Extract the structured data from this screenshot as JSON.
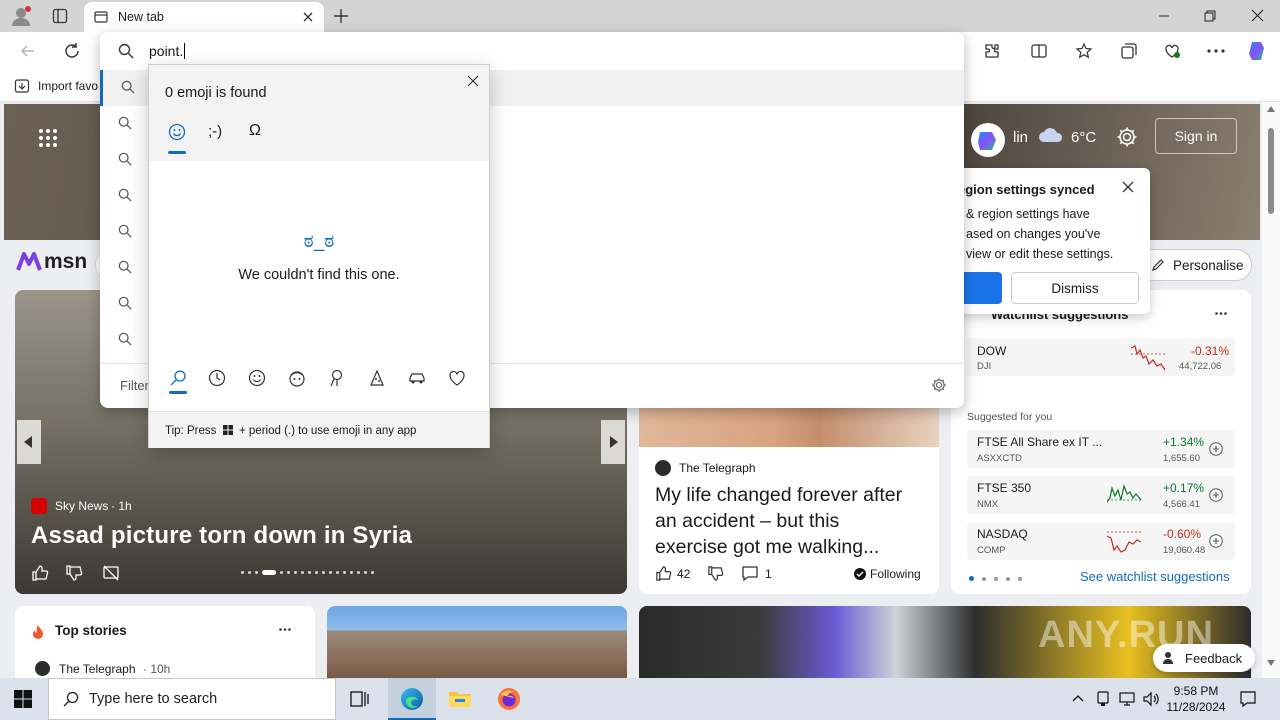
{
  "browser": {
    "tab_title": "New tab",
    "address_text": "point.",
    "bookmark_import": "Import favo",
    "filter_label": "Filter"
  },
  "emoji_panel": {
    "status": "0 emoji is found",
    "kaomoji_tab": ";-)",
    "symbols_tab": "Ω",
    "empty_face": "ಠ_ಠ",
    "empty_text": "We couldn't find this one.",
    "tip_prefix": "Tip: Press",
    "tip_suffix": "+ period (.) to use emoji in any app"
  },
  "msn": {
    "logo": "msn",
    "weather_city": "Berlin",
    "weather_city_visible": "lin",
    "weather_temp": "6°C",
    "sign_in": "Sign in",
    "personalise": "Personalise"
  },
  "popup": {
    "title": "egion settings synced",
    "body_line1": "& region settings have",
    "body_line2": "ased on changes you've",
    "body_line3": "view or edit these settings.",
    "dismiss": "Dismiss"
  },
  "hero_story": {
    "source": "Sky News",
    "age": "· 1h",
    "title": "Assad picture torn down in Syria"
  },
  "telegraph_card": {
    "source": "The Telegraph",
    "title_line1": "My life changed forever after",
    "title_line2": "an accident – but this",
    "title_line3": "exercise got me walking...",
    "likes": "42",
    "comments": "1",
    "following": "Following"
  },
  "watchlist": {
    "title": "Watchlist suggestions",
    "top": {
      "name": "DOW",
      "symbol": "DJI",
      "change": "-0.31%",
      "value": "44,722.06"
    },
    "suggested_label": "Suggested for you",
    "items": [
      {
        "name": "FTSE All Share ex IT ...",
        "symbol": "ASXXCTD",
        "change": "+1.34%",
        "value": "1,655.60"
      },
      {
        "name": "FTSE 350",
        "symbol": "NMX",
        "change": "+0.17%",
        "value": "4,566.41"
      },
      {
        "name": "NASDAQ",
        "symbol": "COMP",
        "change": "-0.60%",
        "value": "19,060.48"
      }
    ],
    "see_more": "See watchlist suggestions"
  },
  "top_stories": {
    "title": "Top stories",
    "first_source": "The Telegraph",
    "first_age": "· 10h"
  },
  "feedback": "Feedback",
  "watermark": "ANY.RUN",
  "taskbar": {
    "search_placeholder": "Type here to search",
    "time": "9:58 PM",
    "date": "11/28/2024"
  }
}
